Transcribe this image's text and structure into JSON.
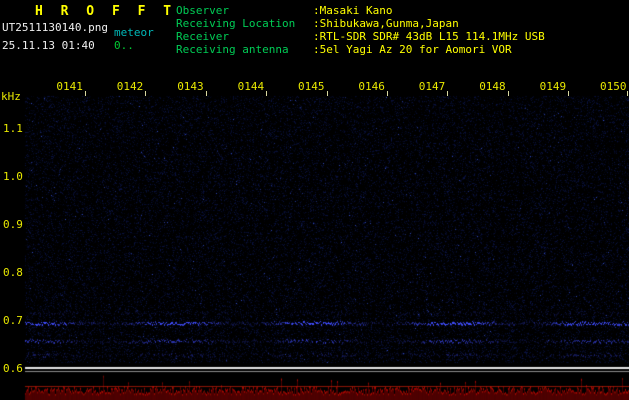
{
  "header": {
    "app_title": "H R O F F T",
    "filename": "UT2511130140.png",
    "mode_label": "meteor",
    "datetime": "25.11.13 01:40",
    "status": "0..",
    "info_rows": [
      {
        "label": "Observer",
        "value": ":Masaki Kano"
      },
      {
        "label": "Receiving Location",
        "value": ":Shibukawa,Gunma,Japan"
      },
      {
        "label": "Receiver",
        "value": ":RTL-SDR SDR# 43dB L15 114.1MHz USB"
      },
      {
        "label": "Receiving antenna",
        "value": ":5el Yagi Az 20 for Aomori VOR"
      }
    ]
  },
  "colors": {
    "title_yellow": "#ffff00",
    "text_white": "#f0f0f0",
    "mode_cyan": "#00b8b8",
    "status_green": "#00cc33",
    "info_label_green": "#00cc55",
    "info_value_yellow": "#ffff00",
    "axis_yellow": "#e8e800",
    "tick_mark": "#d8d8a0",
    "noise_blue": "#2233bb",
    "signal_blue": "#3a4cdd",
    "separator_white": "#e8e8e8",
    "separator_gray": "#8f8f8f",
    "meter_red": "#aa1100",
    "meter_dark_red": "#700000"
  },
  "chart_data": {
    "type": "heatmap",
    "y_unit": "kHz",
    "y_ticks": [
      "1.1",
      "1.0",
      "0.9",
      "0.8",
      "0.7",
      "0.6"
    ],
    "x_ticks": [
      "0141",
      "0142",
      "0143",
      "0144",
      "0145",
      "0146",
      "0147",
      "0148",
      "0149",
      "0150"
    ],
    "ylim": [
      0.6,
      1.17
    ],
    "background": "dark blue noise speckle on black",
    "features": [
      {
        "kind": "carrier-band",
        "freq_khz": 0.693,
        "alpha": 0.9,
        "coverage": 0.97,
        "note": "continuous weak carrier line"
      },
      {
        "kind": "carrier-band",
        "freq_khz": 0.656,
        "alpha": 0.55,
        "coverage": 0.8,
        "note": "fainter intermittent band"
      },
      {
        "kind": "carrier-band",
        "freq_khz": 0.627,
        "alpha": 0.3,
        "coverage": 0.5,
        "note": "very faint patchy band"
      },
      {
        "kind": "carrier-band",
        "freq_khz": 0.715,
        "alpha": 0.18,
        "coverage": 0.35,
        "note": "faint fuzz above main carrier"
      }
    ],
    "separator_line_khz": 0.6,
    "meter": {
      "description": "audio signal-level strip at bottom, dark red jagged bars"
    }
  }
}
